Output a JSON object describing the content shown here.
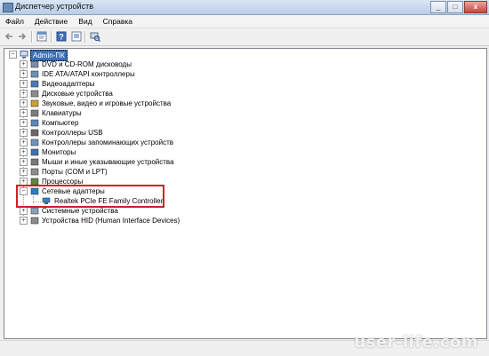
{
  "window": {
    "title": "Диспетчер устройств",
    "buttons": [
      "_",
      "□",
      "x"
    ]
  },
  "menu": [
    "Файл",
    "Действие",
    "Вид",
    "Справка"
  ],
  "tree": {
    "root": "Admin-ПК",
    "categories": [
      {
        "label": "DVD и CD-ROM дисководы",
        "icon": "dvd-drive-icon",
        "expanded": false
      },
      {
        "label": "IDE ATA/ATAPI контроллеры",
        "icon": "ide-controller-icon",
        "expanded": false
      },
      {
        "label": "Видеоадаптеры",
        "icon": "display-adapter-icon",
        "expanded": false
      },
      {
        "label": "Дисковые устройства",
        "icon": "disk-drive-icon",
        "expanded": false
      },
      {
        "label": "Звуковые, видео и игровые устройства",
        "icon": "sound-icon",
        "expanded": false
      },
      {
        "label": "Клавиатуры",
        "icon": "keyboard-icon",
        "expanded": false
      },
      {
        "label": "Компьютер",
        "icon": "computer-icon",
        "expanded": false
      },
      {
        "label": "Контроллеры USB",
        "icon": "usb-icon",
        "expanded": false
      },
      {
        "label": "Контроллеры запоминающих устройств",
        "icon": "storage-controller-icon",
        "expanded": false
      },
      {
        "label": "Мониторы",
        "icon": "monitor-icon",
        "expanded": false
      },
      {
        "label": "Мыши и иные указывающие устройства",
        "icon": "mouse-icon",
        "expanded": false
      },
      {
        "label": "Порты (COM и LPT)",
        "icon": "port-icon",
        "expanded": false
      },
      {
        "label": "Процессоры",
        "icon": "processor-icon",
        "expanded": false
      },
      {
        "label": "Сетевые адаптеры",
        "icon": "network-adapter-icon",
        "expanded": true,
        "children": [
          "Realtek PCIe FE Family Controller"
        ]
      },
      {
        "label": "Системные устройства",
        "icon": "system-device-icon",
        "expanded": false
      },
      {
        "label": "Устройства HID (Human Interface Devices)",
        "icon": "hid-icon",
        "expanded": false
      }
    ]
  },
  "watermark": "user-life.com",
  "colors": {
    "highlight": "#d61a2a",
    "selection": "#3b6fb6"
  }
}
